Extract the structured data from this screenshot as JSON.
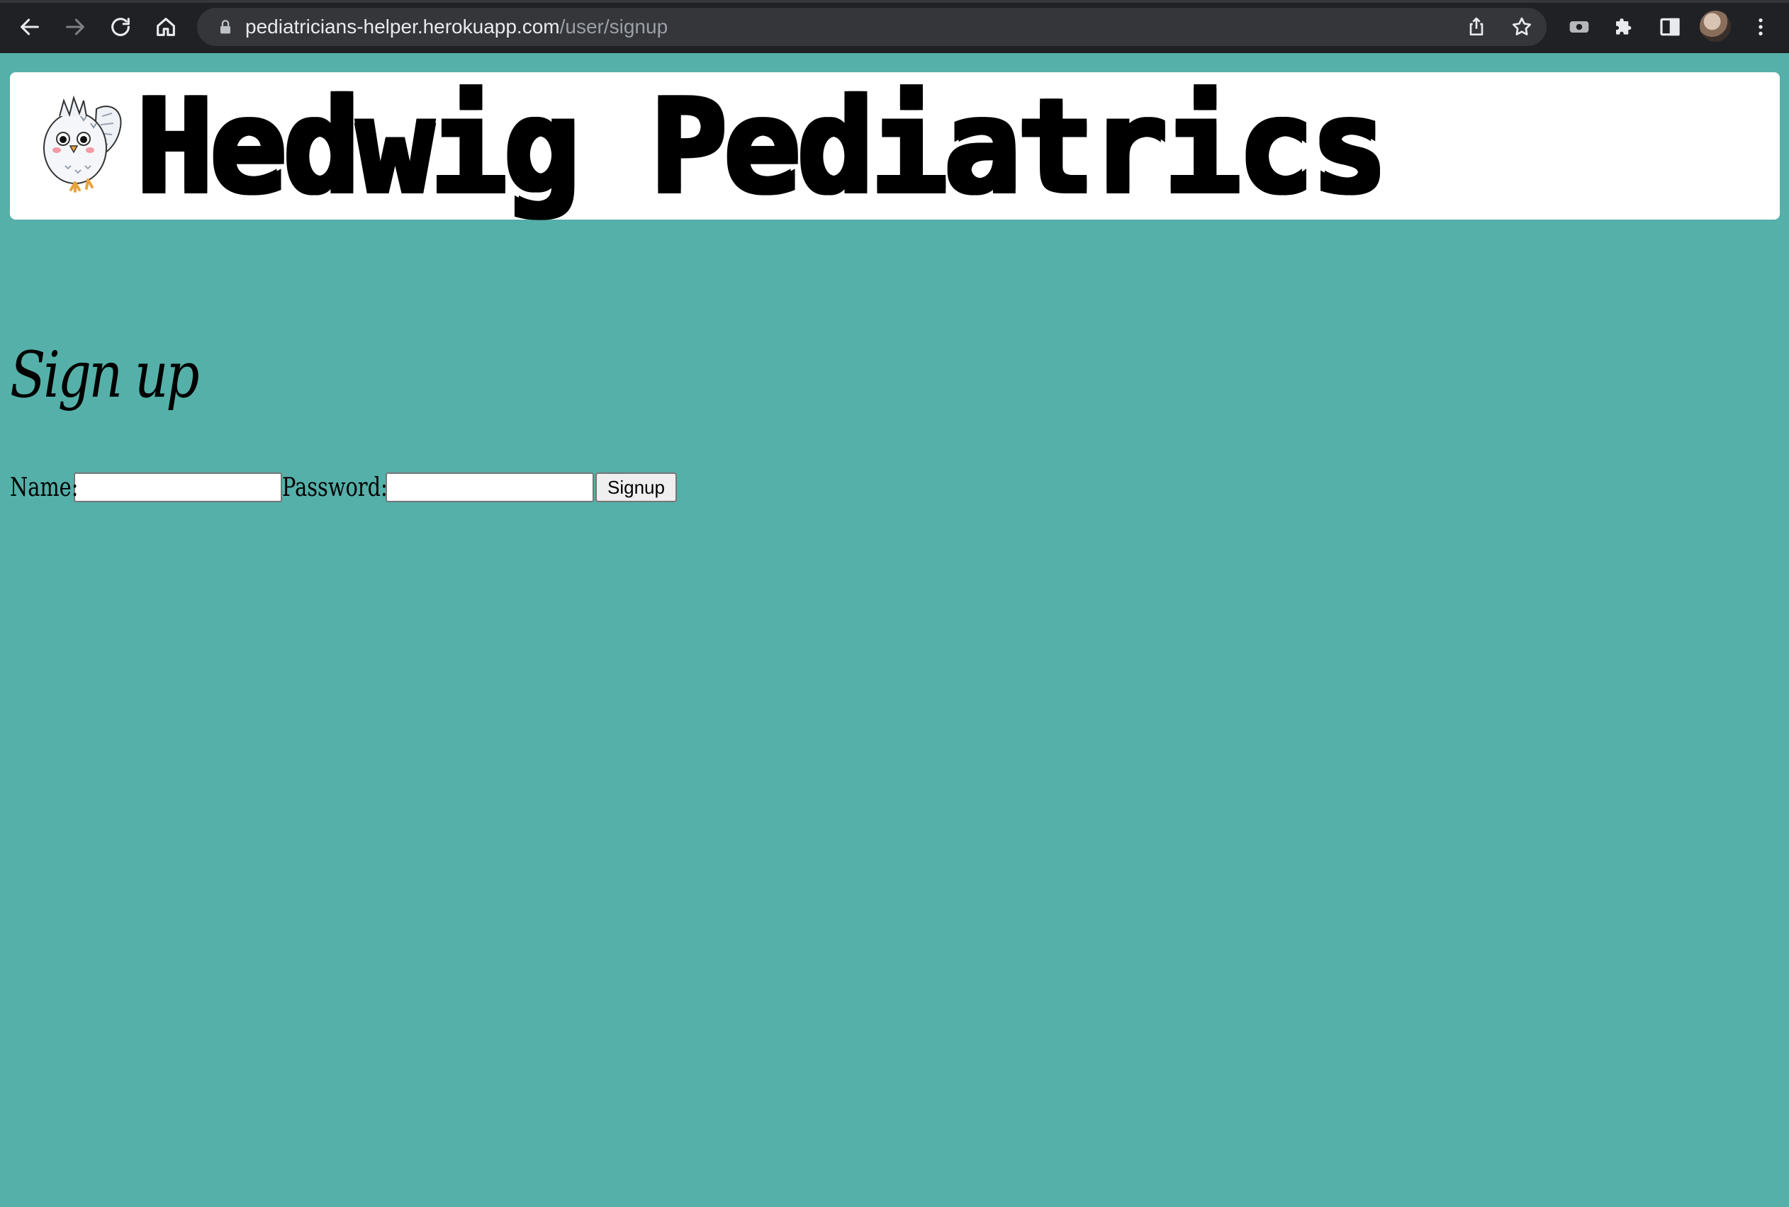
{
  "browser": {
    "url_host": "pediatricians-helper.herokuapp.com",
    "url_path": "/user/signup",
    "icons": {
      "back": "back-arrow-icon",
      "forward": "forward-arrow-icon",
      "reload": "reload-icon",
      "home": "home-icon",
      "lock": "lock-icon",
      "share": "share-icon",
      "bookmark": "star-icon",
      "extension_camera": "camera-icon",
      "extensions": "puzzle-icon",
      "side_panel": "side-panel-icon",
      "menu": "kebab-menu-icon"
    }
  },
  "header": {
    "logo": "owl-logo",
    "title": "Hedwig Pediatrics"
  },
  "main": {
    "heading": "Sign up",
    "form": {
      "name_label": "Name:",
      "name_value": "",
      "password_label": "Password:",
      "password_value": "",
      "submit_label": "Signup"
    }
  },
  "colors": {
    "page_background": "#55b0a9",
    "header_background": "#ffffff",
    "browser_chrome": "#202124"
  }
}
